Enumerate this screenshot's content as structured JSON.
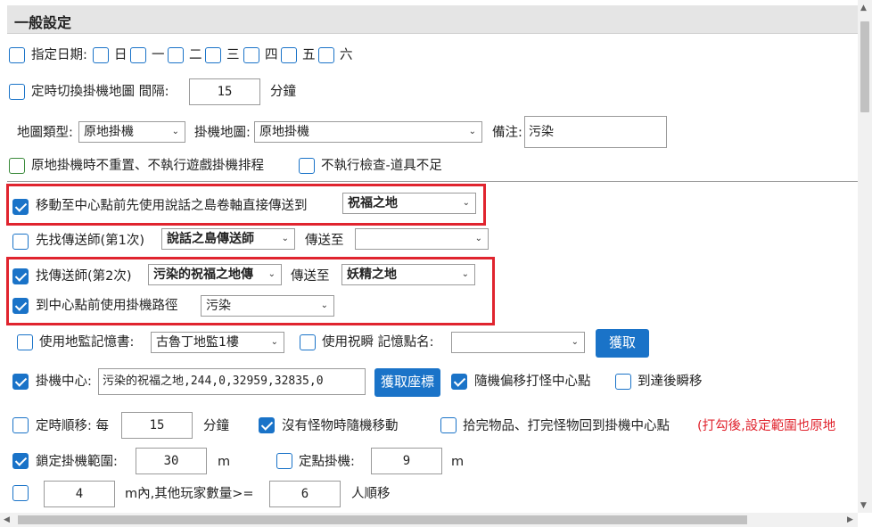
{
  "header": {
    "title": "一般設定"
  },
  "row1": {
    "assign_date_label": "指定日期:",
    "days": [
      "日",
      "一",
      "二",
      "三",
      "四",
      "五",
      "六"
    ]
  },
  "row2": {
    "timer_switch_label": "定時切換掛機地圖 間隔:",
    "interval_value": "15",
    "unit": "分鐘"
  },
  "row3": {
    "map_type_label": "地圖類型:",
    "map_type_value": "原地掛機",
    "hang_map_label": "掛機地圖:",
    "hang_map_value": "原地掛機",
    "note_label": "備注:",
    "note_value": "污染"
  },
  "row4": {
    "no_reset_label": "原地掛機時不重置、不執行遊戲掛機排程",
    "no_check_label": "不執行檢查-道具不足"
  },
  "row5": {
    "teleport_label": "移動至中心點前先使用說話之島卷軸直接傳送到",
    "teleport_value": "祝福之地"
  },
  "row6": {
    "first_teleporter_label": "先找傳送師(第1次)",
    "first_teleporter_value": "說話之島傳送師",
    "teleport_to_label": "傳送至",
    "teleport_to_value": ""
  },
  "row7": {
    "second_teleporter_label": "找傳送師(第2次)",
    "second_teleporter_value": "污染的祝福之地傳",
    "teleport_to_label": "傳送至",
    "teleport_to_value": "妖精之地"
  },
  "row8": {
    "use_path_label": "到中心點前使用掛機路徑",
    "path_value": "污染"
  },
  "row9": {
    "use_book_label": "使用地監記憶書:",
    "book_value": "古魯丁地監1樓",
    "use_bless_label": "使用祝瞬 記憶點名:",
    "bless_value": "",
    "fetch_button": "獲取"
  },
  "row10": {
    "center_label": "掛機中心:",
    "center_value": "污染的祝福之地,244,0,32959,32835,0",
    "get_coords_button": "獲取座標",
    "random_offset_label": "隨機偏移打怪中心點",
    "teleport_after_label": "到達後瞬移"
  },
  "row11": {
    "timed_move_label": "定時順移: 每",
    "timed_move_value": "15",
    "unit": "分鐘",
    "random_move_label": "沒有怪物時隨機移動",
    "return_center_label": "拾完物品、打完怪物回到掛機中心點",
    "warning_text": "(打勾後,設定範圍也原地"
  },
  "row12": {
    "lock_range_label": "鎖定掛機範圍:",
    "lock_range_value": "30",
    "unit_m": "m",
    "fixed_point_label": "定點掛機:",
    "fixed_point_value": "9",
    "unit_m2": "m"
  },
  "row13": {
    "range_value": "4",
    "others_label": "m內,其他玩家數量>=",
    "count_value": "6",
    "people_label": "人順移"
  },
  "colors": {
    "accent": "#1a73c8",
    "highlight": "#e0242e",
    "header_bg": "#e5e5e5"
  }
}
